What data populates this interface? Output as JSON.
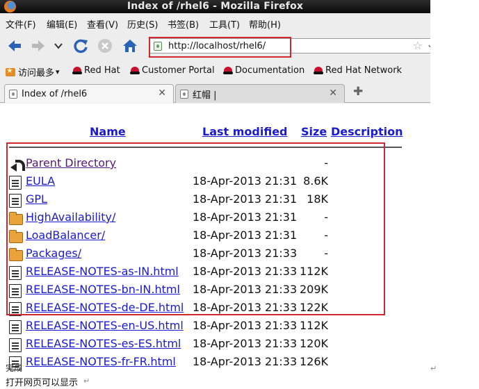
{
  "window": {
    "title": "Index of /rhel6 - Mozilla Firefox"
  },
  "menu": [
    {
      "label": "文件(F)"
    },
    {
      "label": "编辑(E)"
    },
    {
      "label": "查看(V)"
    },
    {
      "label": "历史(S)"
    },
    {
      "label": "书签(B)"
    },
    {
      "label": "工具(T)"
    },
    {
      "label": "帮助(H)"
    }
  ],
  "nav": {
    "url": "http://localhost/rhel6/"
  },
  "bookmarks": [
    {
      "label": "访问最多",
      "icon": "most-visited-icon"
    },
    {
      "label": "Red Hat",
      "icon": "redhat-icon"
    },
    {
      "label": "Customer Portal",
      "icon": "redhat-icon"
    },
    {
      "label": "Documentation",
      "icon": "redhat-icon"
    },
    {
      "label": "Red Hat Network",
      "icon": "redhat-icon"
    }
  ],
  "tabs": [
    {
      "label": "Index of /rhel6",
      "active": true
    },
    {
      "label": "红帽 |",
      "active": false
    }
  ],
  "listing": {
    "headers": {
      "name": "Name",
      "modified": "Last modified",
      "size": "Size",
      "description": "Description"
    },
    "rows": [
      {
        "name": "Parent Directory",
        "date": "",
        "size": "-",
        "icon": "parent-directory-icon"
      },
      {
        "name": "EULA",
        "date": "18-Apr-2013 21:31",
        "size": "8.6K",
        "icon": "document-icon"
      },
      {
        "name": "GPL",
        "date": "18-Apr-2013 21:31",
        "size": "18K",
        "icon": "document-icon"
      },
      {
        "name": "HighAvailability/",
        "date": "18-Apr-2013 21:31",
        "size": "-",
        "icon": "folder-icon"
      },
      {
        "name": "LoadBalancer/",
        "date": "18-Apr-2013 21:31",
        "size": "-",
        "icon": "folder-icon"
      },
      {
        "name": "Packages/",
        "date": "18-Apr-2013 21:33",
        "size": "-",
        "icon": "folder-icon"
      },
      {
        "name": "RELEASE-NOTES-as-IN.html",
        "date": "18-Apr-2013 21:33",
        "size": "112K",
        "icon": "document-icon"
      },
      {
        "name": "RELEASE-NOTES-bn-IN.html",
        "date": "18-Apr-2013 21:33",
        "size": "209K",
        "icon": "document-icon"
      },
      {
        "name": "RELEASE-NOTES-de-DE.html",
        "date": "18-Apr-2013 21:33",
        "size": "122K",
        "icon": "document-icon"
      },
      {
        "name": "RELEASE-NOTES-en-US.html",
        "date": "18-Apr-2013 21:33",
        "size": "112K",
        "icon": "document-icon"
      },
      {
        "name": "RELEASE-NOTES-es-ES.html",
        "date": "18-Apr-2013 21:33",
        "size": "120K",
        "icon": "document-icon"
      },
      {
        "name": "RELEASE-NOTES-fr-FR.html",
        "date": "18-Apr-2013 21:33",
        "size": "126K",
        "icon": "document-icon"
      }
    ]
  },
  "status": {
    "text": "完成"
  },
  "caption": {
    "text": "打开网页可以显示"
  },
  "colors": {
    "link": "#1a1ad0",
    "visited": "#58187a",
    "highlight": "#d0282d"
  }
}
